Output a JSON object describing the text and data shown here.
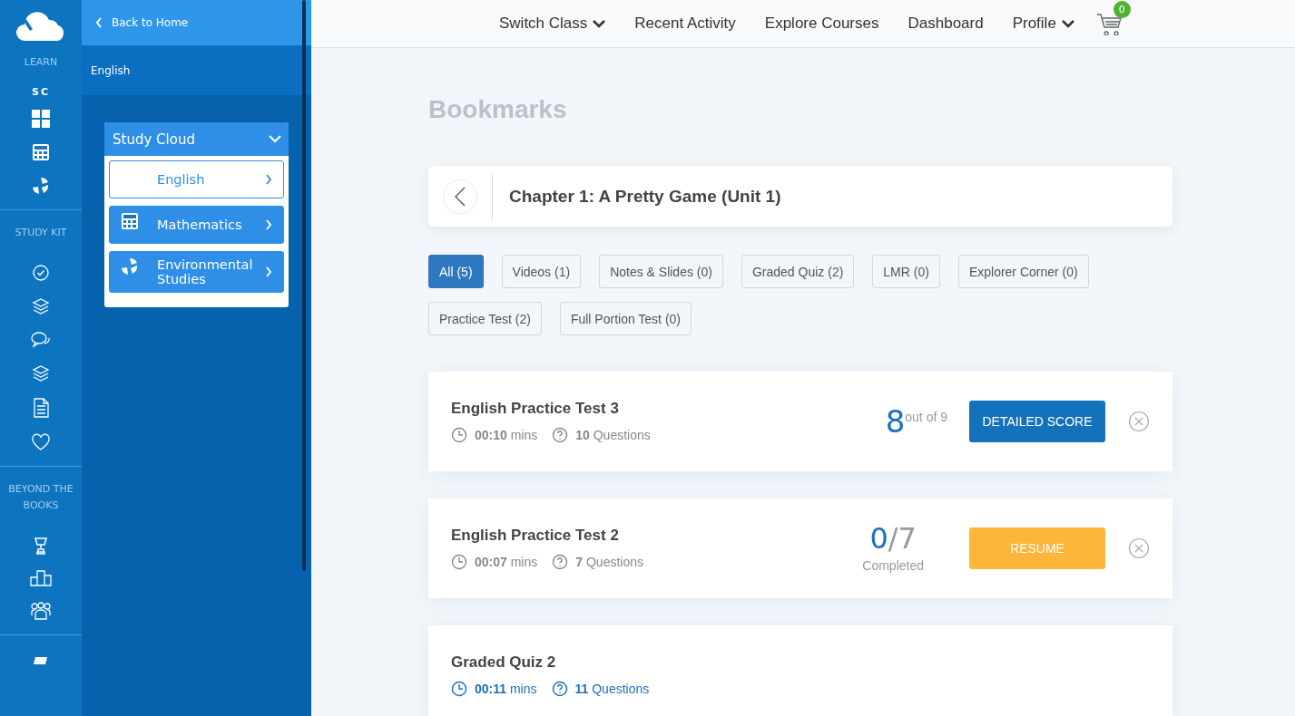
{
  "rail": {
    "sections": [
      {
        "label": "LEARN"
      },
      {
        "label": "STUDY KIT"
      },
      {
        "label": "BEYOND THE BOOKS"
      }
    ],
    "sc_label": "SC"
  },
  "panel": {
    "back": "Back to Home",
    "subtitle": "English",
    "group_title": "Study Cloud",
    "expanded": true,
    "subjects": [
      {
        "label": "English",
        "selected": true
      },
      {
        "label": "Mathematics",
        "selected": false
      },
      {
        "label": "Environmental Studies",
        "selected": false
      }
    ]
  },
  "nav": [
    {
      "label": "Switch Class",
      "dropdown": true
    },
    {
      "label": "Recent Activity",
      "dropdown": false
    },
    {
      "label": "Explore Courses",
      "dropdown": false
    },
    {
      "label": "Dashboard",
      "dropdown": false
    },
    {
      "label": "Profile",
      "dropdown": true
    }
  ],
  "cart": {
    "count": "0"
  },
  "page_title": "Bookmarks",
  "chapter": "Chapter 1: A Pretty Game (Unit 1)",
  "filters": [
    {
      "label": "All (5)",
      "selected": true
    },
    {
      "label": "Videos (1)",
      "selected": false
    },
    {
      "label": "Notes & Slides (0)",
      "selected": false
    },
    {
      "label": "Graded Quiz (2)",
      "selected": false
    },
    {
      "label": "LMR (0)",
      "selected": false
    },
    {
      "label": "Explorer Corner (0)",
      "selected": false
    },
    {
      "label": "Practice Test (2)",
      "selected": false
    },
    {
      "label": "Full Portion Test (0)",
      "selected": false
    }
  ],
  "items": [
    {
      "kind": "score",
      "title": "English Practice Test 3",
      "time": "00:10",
      "time_unit": "mins",
      "questions": "10",
      "questions_unit": "Questions",
      "highlighted": false,
      "score": "8",
      "score_suffix": "out of 9",
      "button": "DETAILED SCORE"
    },
    {
      "kind": "progress",
      "title": "English Practice Test 2",
      "time": "00:07",
      "time_unit": "mins",
      "questions": "7",
      "questions_unit": "Questions",
      "highlighted": false,
      "done": "0",
      "total": "/7",
      "caption": "Completed",
      "button": "RESUME"
    },
    {
      "kind": "start",
      "title": "Graded Quiz 2",
      "time": "00:11",
      "time_unit": "mins",
      "questions": "11",
      "questions_unit": "Questions",
      "highlighted": true
    }
  ]
}
